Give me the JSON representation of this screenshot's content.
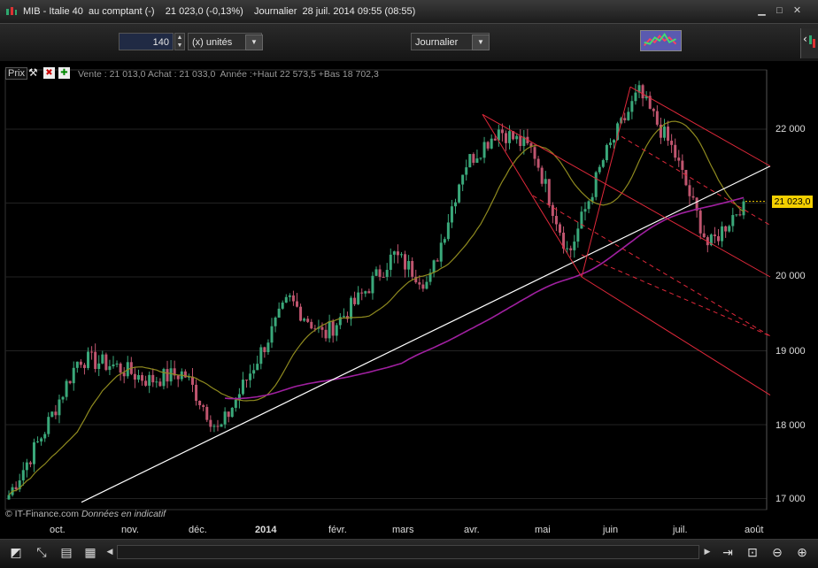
{
  "window": {
    "title": "MIB - Italie 40  au compt​ant (-)    21 023,0 (-0,13%)    Journalier  28 juil. 2014 09:55 (08:55)"
  },
  "toolbar": {
    "units_value": "140",
    "units_label": "(x) unités",
    "period_value": "Journalier"
  },
  "chart_header": {
    "prix_label": "Prix",
    "info": "Vente : 21 013,0 Achat : 21 033,0  Année :+Haut 22 573,5 +Bas 18 702,3"
  },
  "colors": {
    "up_candle": "#3aa87a",
    "down_candle": "#c0556f",
    "ma_short": "#8f8a1f",
    "ma_long": "#a020a0",
    "trendline": "#ffffff",
    "channel": "#e0283a",
    "price_badge": "#f4d000"
  },
  "price_badge": "21 023,0",
  "copyright": {
    "owner": "© IT-Finance.com",
    "note": "Données en indicatif"
  },
  "chart_data": {
    "type": "candlestick",
    "instrument": "MIB - Italie 40",
    "yticks": [
      "22 000",
      "20 000",
      "19 000",
      "18 000",
      "17 000"
    ],
    "xticks": [
      "oct.",
      "nov.",
      "déc.",
      "2014",
      "févr.",
      "mars",
      "avr.",
      "mai",
      "juin",
      "juil.",
      "août"
    ],
    "ylim": [
      16900,
      22700
    ],
    "last_price": 21023.0,
    "year_high": 22573.5,
    "year_low": 18702.3,
    "close_path": [
      {
        "month": "sept. end",
        "close": 17050
      },
      {
        "month": "oct.",
        "close": 17900
      },
      {
        "month": "oct. end",
        "close": 18900
      },
      {
        "month": "nov.",
        "close": 18800
      },
      {
        "month": "nov. end",
        "close": 18600
      },
      {
        "month": "déc.",
        "close": 18700
      },
      {
        "month": "déc. mid",
        "close": 17900
      },
      {
        "month": "2014",
        "close": 18800
      },
      {
        "month": "janv. mid",
        "close": 19700
      },
      {
        "month": "févr.",
        "close": 19200
      },
      {
        "month": "févr. mid",
        "close": 19700
      },
      {
        "month": "mars",
        "close": 20300
      },
      {
        "month": "mars mid",
        "close": 19900
      },
      {
        "month": "avr.",
        "close": 21500
      },
      {
        "month": "avr. mid",
        "close": 22000
      },
      {
        "month": "mai",
        "close": 21700
      },
      {
        "month": "mai mid",
        "close": 20300
      },
      {
        "month": "juin",
        "close": 21600
      },
      {
        "month": "juin mid",
        "close": 22500
      },
      {
        "month": "juil.",
        "close": 21700
      },
      {
        "month": "juil. mid",
        "close": 20400
      },
      {
        "month": "fin juil.",
        "close": 21023
      }
    ]
  }
}
